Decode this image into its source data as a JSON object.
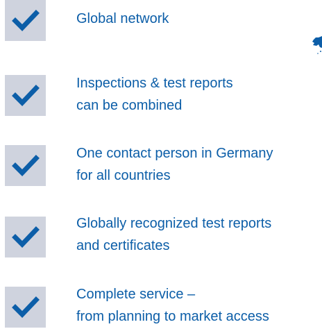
{
  "colors": {
    "text": "#0c5ea8",
    "check_box_background": "#cfd3de",
    "check_mark": "#0c5ea8"
  },
  "benefits": [
    {
      "icon": "checkmark-icon",
      "line1": "Global network",
      "line2": ""
    },
    {
      "icon": "checkmark-icon",
      "line1": "Inspections & test reports",
      "line2": "can be combined"
    },
    {
      "icon": "checkmark-icon",
      "line1": "One contact person in Germany",
      "line2": "for all countries"
    },
    {
      "icon": "checkmark-icon",
      "line1": "Globally recognized test reports",
      "line2": "and certificates"
    },
    {
      "icon": "checkmark-icon",
      "line1": "Complete service –",
      "line2": "from planning to market access"
    }
  ],
  "decoration": {
    "icon": "map-fragment-icon"
  }
}
